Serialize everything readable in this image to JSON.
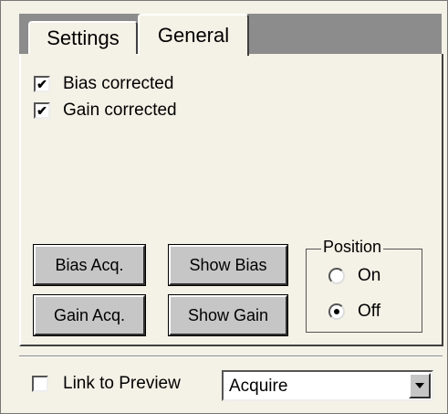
{
  "tabs": [
    {
      "label": "Settings",
      "active": false
    },
    {
      "label": "General",
      "active": true
    }
  ],
  "checkboxes": [
    {
      "label": "Bias corrected",
      "checked": true
    },
    {
      "label": "Gain corrected",
      "checked": true
    }
  ],
  "buttons": {
    "bias_acq": "Bias Acq.",
    "show_bias": "Show Bias",
    "gain_acq": "Gain Acq.",
    "show_gain": "Show Gain"
  },
  "position": {
    "legend": "Position",
    "options": [
      {
        "label": "On",
        "selected": false
      },
      {
        "label": "Off",
        "selected": true
      }
    ]
  },
  "footer": {
    "link_label": "Link to Preview",
    "link_checked": false,
    "select_value": "Acquire"
  },
  "colors": {
    "panel_bg": "#f4f1e6",
    "tabstrip_bg": "#8c8c8c",
    "button_face": "#c6c6c6"
  }
}
